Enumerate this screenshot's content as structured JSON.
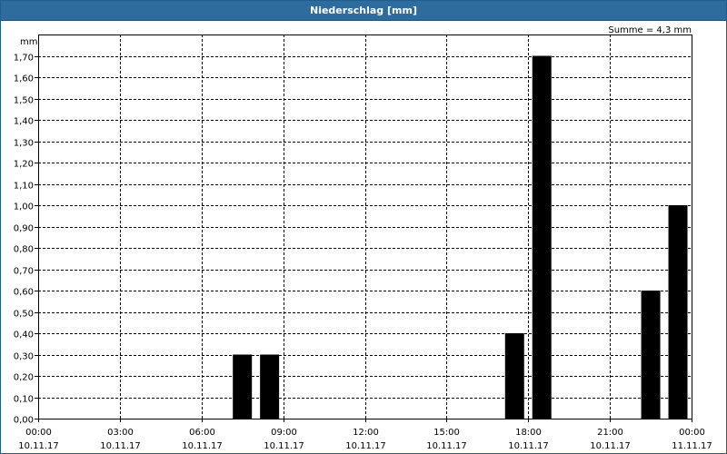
{
  "window": {
    "title": "Niederschlag [mm]"
  },
  "chart_data": {
    "type": "bar",
    "title": "Niederschlag [mm]",
    "ylabel": "mm",
    "sum_label": "Summe = 4,3 mm",
    "ylim": [
      0,
      1.8
    ],
    "y_ticks": [
      0,
      0.1,
      0.2,
      0.3,
      0.4,
      0.5,
      0.6,
      0.7,
      0.8,
      0.9,
      1.0,
      1.1,
      1.2,
      1.3,
      1.4,
      1.5,
      1.6,
      1.7
    ],
    "y_tick_labels": [
      "0,00",
      "0,10",
      "0,20",
      "0,30",
      "0,40",
      "0,50",
      "0,60",
      "0,70",
      "0,80",
      "0,90",
      "1,00",
      "1,10",
      "1,20",
      "1,30",
      "1,40",
      "1,50",
      "1,60",
      "1,70"
    ],
    "x_range_hours": [
      0,
      24
    ],
    "x_ticks": [
      {
        "hours": 0,
        "time": "00:00",
        "date": "10.11.17"
      },
      {
        "hours": 3,
        "time": "03:00",
        "date": "10.11.17"
      },
      {
        "hours": 6,
        "time": "06:00",
        "date": "10.11.17"
      },
      {
        "hours": 9,
        "time": "09:00",
        "date": "10.11.17"
      },
      {
        "hours": 12,
        "time": "12:00",
        "date": "10.11.17"
      },
      {
        "hours": 15,
        "time": "15:00",
        "date": "10.11.17"
      },
      {
        "hours": 18,
        "time": "18:00",
        "date": "10.11.17"
      },
      {
        "hours": 21,
        "time": "21:00",
        "date": "10.11.17"
      },
      {
        "hours": 24,
        "time": "00:00",
        "date": "11.11.17"
      }
    ],
    "bars": [
      {
        "hours": 7.5,
        "value": 0.3
      },
      {
        "hours": 8.5,
        "value": 0.3
      },
      {
        "hours": 17.5,
        "value": 0.4
      },
      {
        "hours": 18.5,
        "value": 1.7
      },
      {
        "hours": 22.5,
        "value": 0.6
      },
      {
        "hours": 23.5,
        "value": 1.0
      }
    ],
    "grid": true,
    "colors": {
      "bar": "#000000",
      "title_bar": "#2d6c9c",
      "grid": "#000000"
    }
  }
}
